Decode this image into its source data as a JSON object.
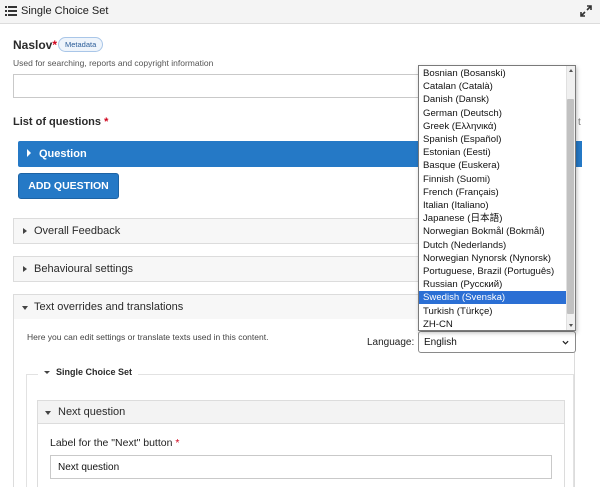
{
  "header": {
    "title": "Single Choice Set",
    "library_icon": "list-icon",
    "fullscreen_icon": "expand-icon"
  },
  "title_field": {
    "label": "Naslov",
    "required_mark": "*",
    "metadata_button": "Metadata",
    "description": "Used for searching, reports and copyright information",
    "value": ""
  },
  "questions": {
    "label": "List of questions",
    "required_mark": "*",
    "partial_text": "t",
    "items": [
      {
        "label": "Question"
      }
    ],
    "add_button": "ADD QUESTION"
  },
  "sections": [
    {
      "label": "Overall Feedback",
      "expanded": false
    },
    {
      "label": "Behavioural settings",
      "expanded": false
    },
    {
      "label": "Text overrides and translations",
      "expanded": true
    }
  ],
  "translations": {
    "description": "Here you can edit settings or translate texts used in this content.",
    "language_label": "Language:",
    "selected_language": "English",
    "group_label": "Single Choice Set",
    "subsection_label": "Next question",
    "next_label": "Label for the \"Next\" button",
    "next_required_mark": "*",
    "next_value": "Next question"
  },
  "language_dropdown": {
    "options": [
      "Bosnian (Bosanski)",
      "Catalan (Català)",
      "Danish (Dansk)",
      "German (Deutsch)",
      "Greek (Ελληνικά)",
      "Spanish (Español)",
      "Estonian (Eesti)",
      "Basque (Euskera)",
      "Finnish (Suomi)",
      "French (Français)",
      "Italian (Italiano)",
      "Japanese (日本語)",
      "Norwegian Bokmål (Bokmål)",
      "Dutch (Nederlands)",
      "Norwegian Nynorsk (Nynorsk)",
      "Portuguese, Brazil (Português)",
      "Russian (Русский)",
      "Swedish (Svenska)",
      "Turkish (Türkçe)",
      "ZH-CN"
    ],
    "highlighted": "Swedish (Svenska)"
  },
  "colors": {
    "accent": "#2579c6",
    "required": "#d0021b",
    "highlight": "#2b6fd4"
  }
}
